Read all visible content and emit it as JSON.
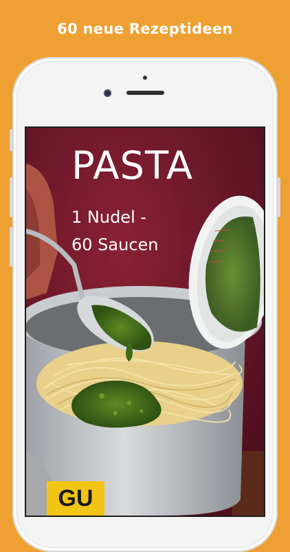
{
  "promo": {
    "headline": "60 neue Rezeptideen"
  },
  "cover": {
    "title": "PASTA",
    "subtitle_line1": "1 Nudel -",
    "subtitle_line2": "60 Saucen",
    "publisher_logo": "GU"
  },
  "colors": {
    "background": "#eea032",
    "cover_background": "#6e1a2c",
    "logo_yellow": "#f2c416"
  }
}
